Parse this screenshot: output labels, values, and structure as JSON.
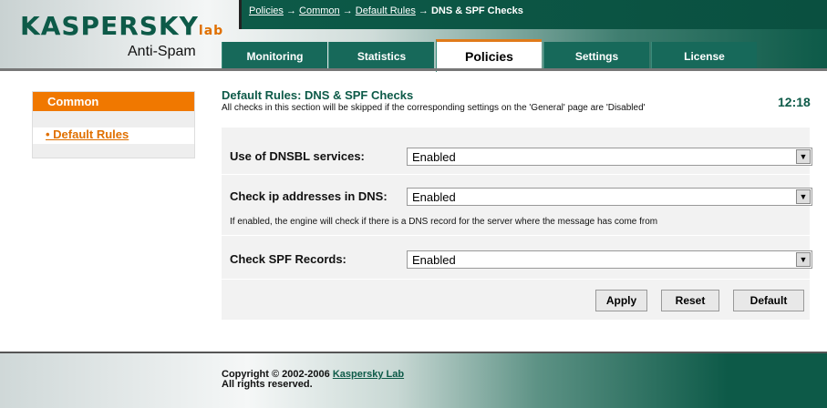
{
  "logo": {
    "brand": "KASPERSKY lab",
    "product": "Anti-Spam"
  },
  "breadcrumb": {
    "items": [
      "Policies",
      "Common",
      "Default Rules"
    ],
    "current": "DNS & SPF Checks",
    "sep": "→"
  },
  "tabs": [
    {
      "label": "Monitoring"
    },
    {
      "label": "Statistics"
    },
    {
      "label": "Policies",
      "active": true
    },
    {
      "label": "Settings"
    },
    {
      "label": "License"
    }
  ],
  "sidebar": {
    "header": "Common",
    "items": [
      {
        "label": "• Default Rules"
      }
    ]
  },
  "main": {
    "title": "Default Rules: DNS & SPF Checks",
    "subtitle": "All checks in this section will be skipped if the corresponding settings on the 'General' page are 'Disabled'",
    "time": "12:18"
  },
  "form": {
    "rows": [
      {
        "label": "Use of DNSBL services:",
        "value": "Enabled"
      },
      {
        "label": "Check ip addresses in DNS:",
        "value": "Enabled",
        "hint": "If enabled, the engine will check if there is a DNS record for the server where the message has come from"
      },
      {
        "label": "Check SPF Records:",
        "value": "Enabled"
      }
    ],
    "buttons": {
      "apply": "Apply",
      "reset": "Reset",
      "default": "Default"
    }
  },
  "footer": {
    "copyright": "Copyright © 2002-2006",
    "link": "Kaspersky Lab",
    "rights": "All rights reserved."
  }
}
